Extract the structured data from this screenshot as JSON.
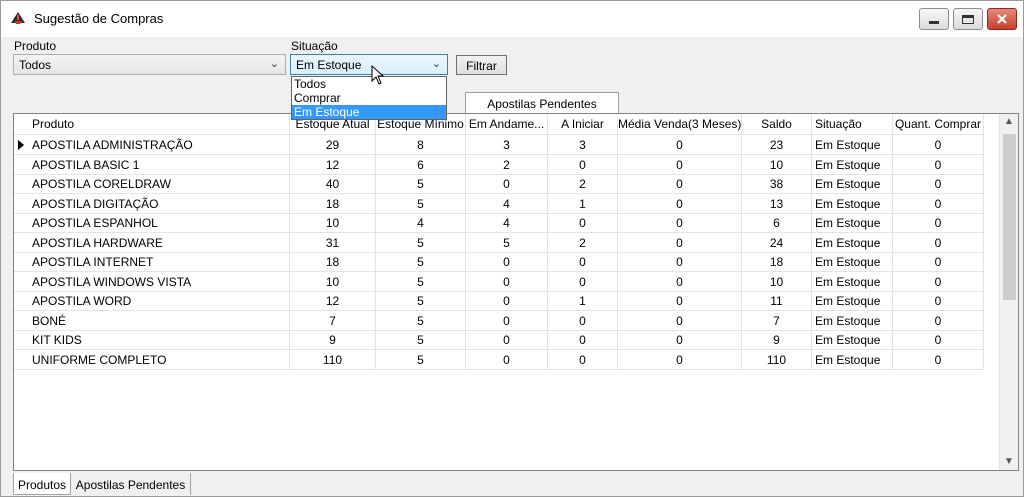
{
  "window": {
    "title": "Sugestão de Compras"
  },
  "filters": {
    "produto_label": "Produto",
    "produto_value": "Todos",
    "situacao_label": "Situação",
    "situacao_value": "Em Estoque",
    "situacao_options": [
      "Todos",
      "Comprar",
      "Em Estoque"
    ],
    "filter_button_label": "Filtrar"
  },
  "tabs": {
    "floating": "Apostilas Pendentes",
    "bottom": [
      "Produtos",
      "Apostilas Pendentes"
    ]
  },
  "table": {
    "headers": [
      "Produto",
      "Estoque Atual",
      "Estoque Mínimo",
      "Em Andame...",
      "A Iniciar",
      "Média Venda(3 Meses)",
      "Saldo",
      "Situação",
      "Quant. Comprar"
    ],
    "rows": [
      [
        "APOSTILA ADMINISTRAÇÃO",
        "29",
        "8",
        "3",
        "3",
        "0",
        "23",
        "Em Estoque",
        "0"
      ],
      [
        "APOSTILA BASIC 1",
        "12",
        "6",
        "2",
        "0",
        "0",
        "10",
        "Em Estoque",
        "0"
      ],
      [
        "APOSTILA CORELDRAW",
        "40",
        "5",
        "0",
        "2",
        "0",
        "38",
        "Em Estoque",
        "0"
      ],
      [
        "APOSTILA DIGITAÇÃO",
        "18",
        "5",
        "4",
        "1",
        "0",
        "13",
        "Em Estoque",
        "0"
      ],
      [
        "APOSTILA ESPANHOL",
        "10",
        "4",
        "4",
        "0",
        "0",
        "6",
        "Em Estoque",
        "0"
      ],
      [
        "APOSTILA HARDWARE",
        "31",
        "5",
        "5",
        "2",
        "0",
        "24",
        "Em Estoque",
        "0"
      ],
      [
        "APOSTILA INTERNET",
        "18",
        "5",
        "0",
        "0",
        "0",
        "18",
        "Em Estoque",
        "0"
      ],
      [
        "APOSTILA WINDOWS VISTA",
        "10",
        "5",
        "0",
        "0",
        "0",
        "10",
        "Em Estoque",
        "0"
      ],
      [
        "APOSTILA WORD",
        "12",
        "5",
        "0",
        "1",
        "0",
        "11",
        "Em Estoque",
        "0"
      ],
      [
        "BONÉ",
        "7",
        "5",
        "0",
        "0",
        "0",
        "7",
        "Em Estoque",
        "0"
      ],
      [
        "KIT KIDS",
        "9",
        "5",
        "0",
        "0",
        "0",
        "9",
        "Em Estoque",
        "0"
      ],
      [
        "UNIFORME COMPLETO",
        "110",
        "5",
        "0",
        "0",
        "0",
        "110",
        "Em Estoque",
        "0"
      ]
    ]
  }
}
